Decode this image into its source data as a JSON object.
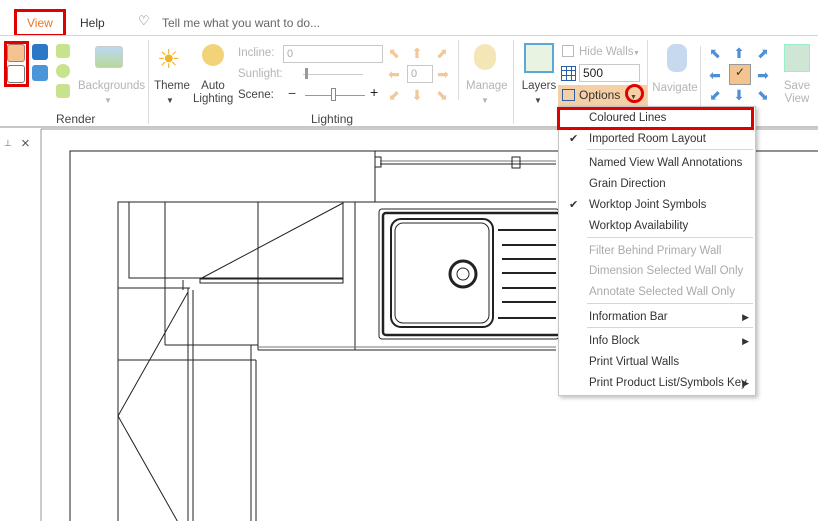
{
  "tabs": {
    "view": "View",
    "help": "Help"
  },
  "search": {
    "placeholder": "Tell me what you want to do..."
  },
  "render": {
    "backgrounds": "Backgrounds",
    "label": "Render"
  },
  "lighting": {
    "theme": "Theme",
    "auto_lighting_1": "Auto",
    "auto_lighting_2": "Lighting",
    "incline_label": "Incline:",
    "incline_value": "0",
    "sunlight_label": "Sunlight:",
    "scene_label": "Scene:",
    "angle_value": "0",
    "minus": "−",
    "plus": "+",
    "label": "Lighting"
  },
  "manage": {
    "label": "Manage"
  },
  "view_group": {
    "layers": "Layers",
    "hide_walls": "Hide Walls",
    "grid_value": "500",
    "options": "Options",
    "navigate": "Navigate",
    "save_view_1": "Save",
    "save_view_2": "View"
  },
  "panel": {
    "pin": "📌",
    "close": "×"
  },
  "options_menu": {
    "items": [
      {
        "label": "Coloured Lines",
        "checked": false,
        "enabled": true
      },
      {
        "label": "Imported Room Layout",
        "checked": true,
        "enabled": true
      },
      {
        "label": "Named View Wall Annotations",
        "checked": false,
        "enabled": true
      },
      {
        "label": "Grain Direction",
        "checked": false,
        "enabled": true
      },
      {
        "label": "Worktop Joint Symbols",
        "checked": true,
        "enabled": true
      },
      {
        "label": "Worktop Availability",
        "checked": false,
        "enabled": true
      },
      {
        "label": "Filter Behind Primary Wall",
        "checked": false,
        "enabled": false
      },
      {
        "label": "Dimension Selected Wall Only",
        "checked": false,
        "enabled": false
      },
      {
        "label": "Annotate Selected Wall Only",
        "checked": false,
        "enabled": false
      },
      {
        "label": "Information Bar",
        "checked": false,
        "enabled": true,
        "submenu": true
      },
      {
        "label": "Info Block",
        "checked": false,
        "enabled": true,
        "submenu": true
      },
      {
        "label": "Print Virtual Walls",
        "checked": false,
        "enabled": true
      },
      {
        "label": "Print Product List/Symbols Key",
        "checked": false,
        "enabled": true,
        "submenu": true
      }
    ],
    "check_glyph": "✔",
    "submenu_glyph": "▶"
  },
  "colors": {
    "accent": "#e87722",
    "highlight": "#f5cfa6",
    "annotation_red": "#e00000"
  }
}
